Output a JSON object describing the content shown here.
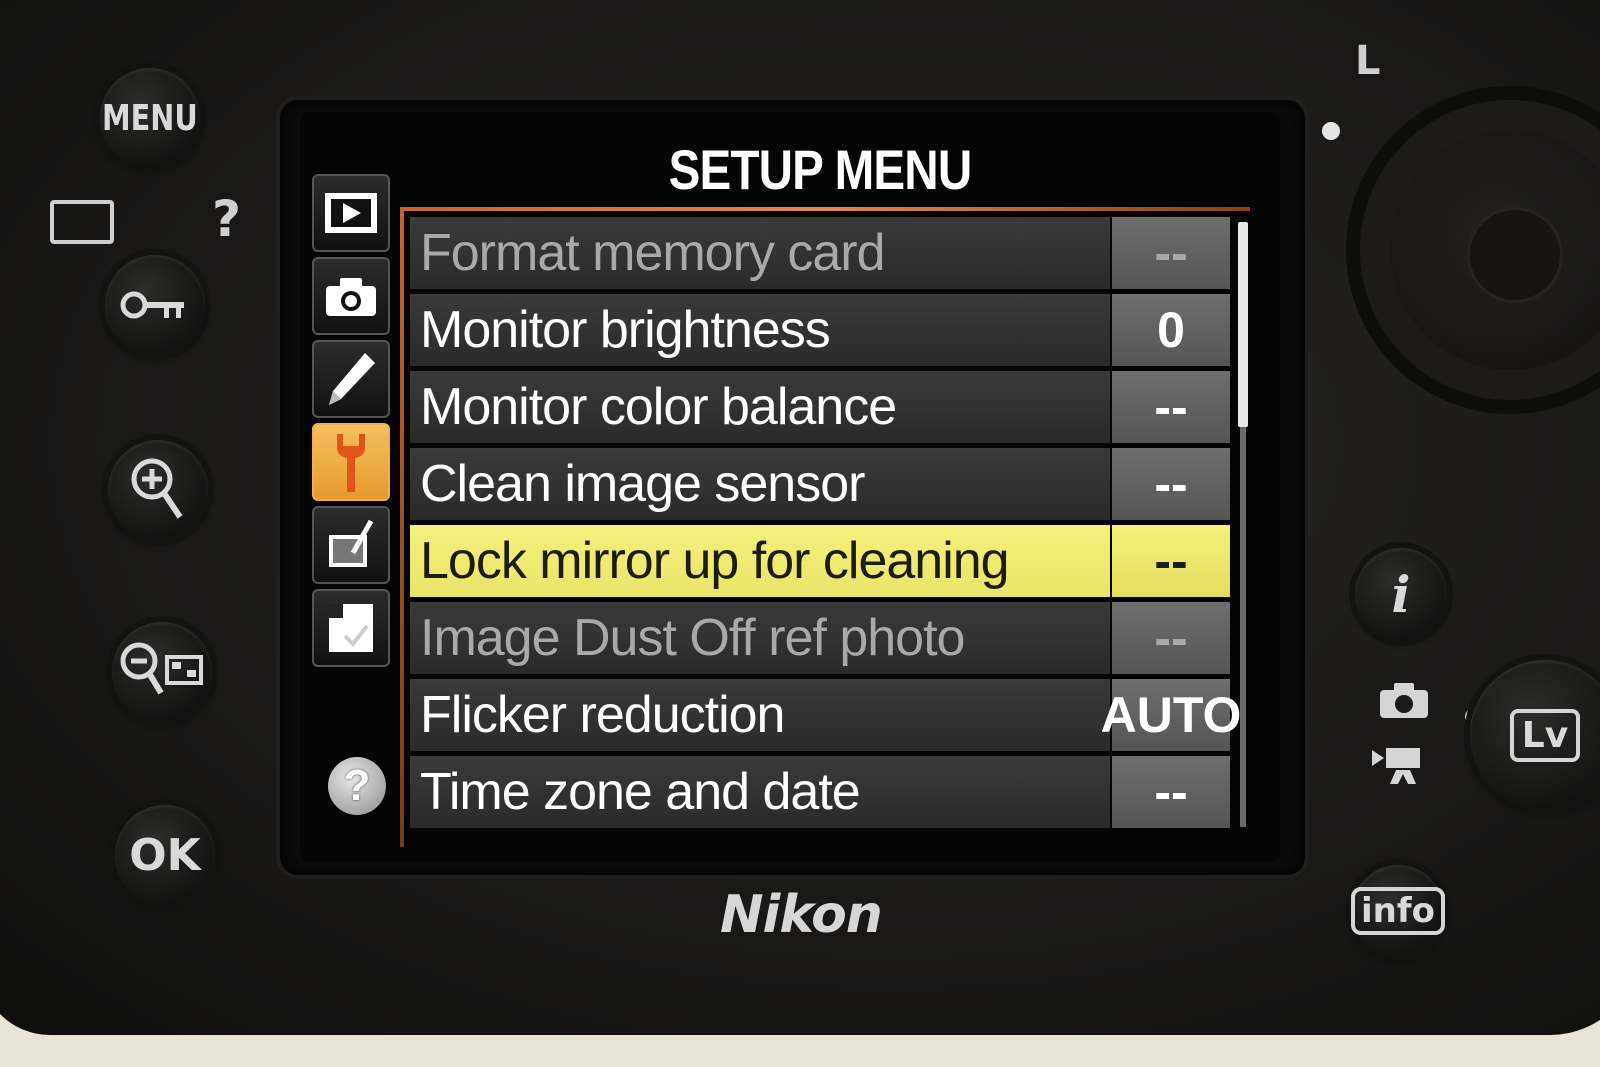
{
  "camera": {
    "brand": "Nikon",
    "left_buttons": {
      "menu": "MENU",
      "help": "?",
      "ok": "OK"
    },
    "right_buttons": {
      "i": "i",
      "lv": "Lv",
      "info": "info"
    },
    "dial_mark": "L"
  },
  "screen": {
    "title": "SETUP MENU",
    "tabs": [
      {
        "name": "playback",
        "icon": "play-icon",
        "active": false
      },
      {
        "name": "photo shooting",
        "icon": "camera-icon",
        "active": false
      },
      {
        "name": "custom settings",
        "icon": "pencil-icon",
        "active": false
      },
      {
        "name": "setup",
        "icon": "wrench-icon",
        "active": true
      },
      {
        "name": "retouch",
        "icon": "retouch-brush-icon",
        "active": false
      },
      {
        "name": "my menu",
        "icon": "my-menu-icon",
        "active": false
      }
    ],
    "help_icon": "?",
    "items": [
      {
        "label": "Format memory card",
        "value": "--",
        "state": "dimmed"
      },
      {
        "label": "Monitor brightness",
        "value": "0",
        "state": "normal"
      },
      {
        "label": "Monitor color balance",
        "value": "--",
        "state": "normal"
      },
      {
        "label": "Clean image sensor",
        "value": "--",
        "state": "normal"
      },
      {
        "label": "Lock mirror up for cleaning",
        "value": "--",
        "state": "selected"
      },
      {
        "label": "Image Dust Off ref photo",
        "value": "--",
        "state": "dimmed"
      },
      {
        "label": "Flicker reduction",
        "value": "AUTO",
        "state": "normal"
      },
      {
        "label": "Time zone and date",
        "value": "--",
        "state": "normal"
      }
    ],
    "colors": {
      "highlight": "#f3f07c",
      "active_tab": "#f0a040",
      "frame_accent": "#c8642a"
    }
  }
}
